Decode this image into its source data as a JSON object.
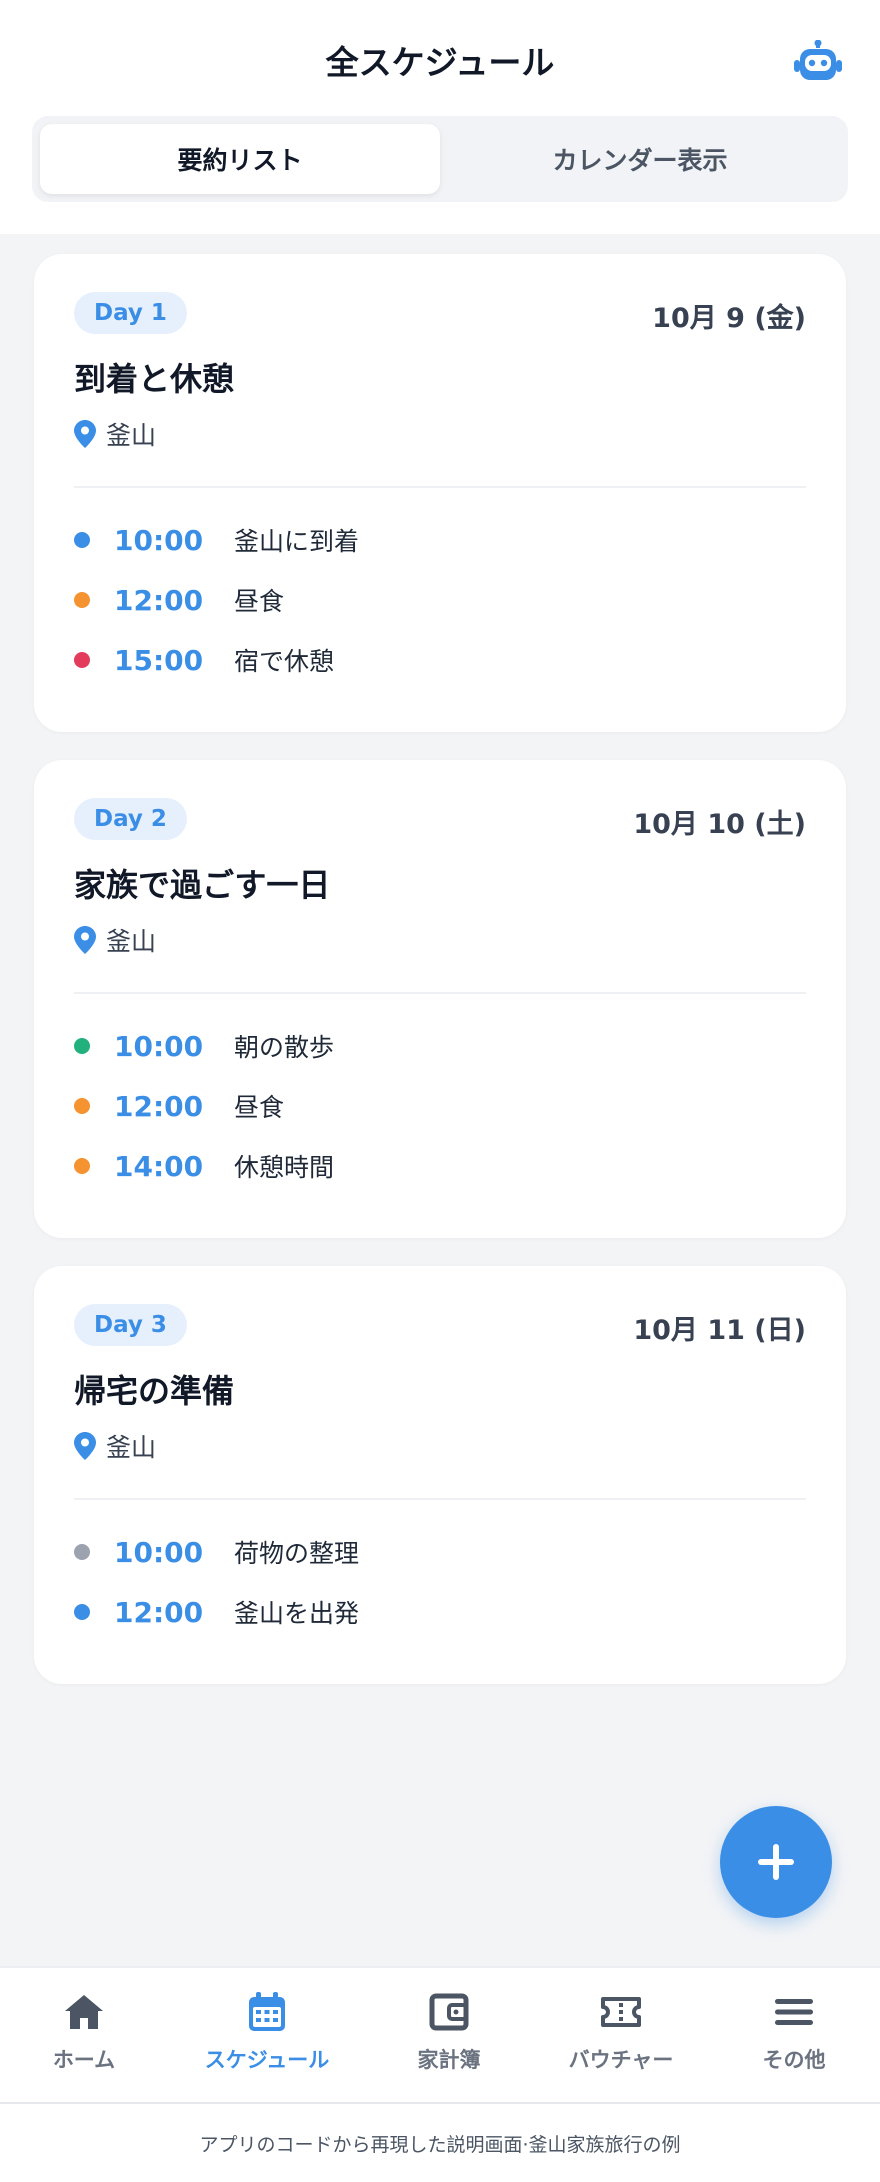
{
  "header": {
    "title": "全スケジュール",
    "bot_icon": "robot-icon",
    "tabs": [
      {
        "label": "要約リスト",
        "active": true
      },
      {
        "label": "カレンダー表示",
        "active": false
      }
    ]
  },
  "days": [
    {
      "badge": "Day 1",
      "date": "10月 9 (金)",
      "title": "到着と休憩",
      "location": "釜山",
      "events": [
        {
          "time": "10:00",
          "name": "釜山に到着",
          "dot_color": "#3b8ee6"
        },
        {
          "time": "12:00",
          "name": "昼食",
          "dot_color": "#f59331"
        },
        {
          "time": "15:00",
          "name": "宿で休憩",
          "dot_color": "#e23b5b"
        }
      ]
    },
    {
      "badge": "Day 2",
      "date": "10月 10 (土)",
      "title": "家族で過ごす一日",
      "location": "釜山",
      "events": [
        {
          "time": "10:00",
          "name": "朝の散歩",
          "dot_color": "#22b07d"
        },
        {
          "time": "12:00",
          "name": "昼食",
          "dot_color": "#f59331"
        },
        {
          "time": "14:00",
          "name": "休憩時間",
          "dot_color": "#f59331"
        }
      ]
    },
    {
      "badge": "Day 3",
      "date": "10月 11 (日)",
      "title": "帰宅の準備",
      "location": "釜山",
      "events": [
        {
          "time": "10:00",
          "name": "荷物の整理",
          "dot_color": "#9ca3af"
        },
        {
          "time": "12:00",
          "name": "釜山を出発",
          "dot_color": "#3b8ee6"
        }
      ]
    }
  ],
  "fab": {
    "icon": "plus-icon"
  },
  "nav": [
    {
      "label": "ホーム",
      "icon": "home-icon",
      "active": false
    },
    {
      "label": "スケジュール",
      "icon": "calendar-icon",
      "active": true
    },
    {
      "label": "家計簿",
      "icon": "wallet-icon",
      "active": false
    },
    {
      "label": "バウチャー",
      "icon": "ticket-icon",
      "active": false
    },
    {
      "label": "その他",
      "icon": "menu-icon",
      "active": false
    }
  ],
  "footer": {
    "caption": "アプリのコードから再現した説明画面·釜山家族旅行の例"
  },
  "colors": {
    "accent": "#3b8ee6",
    "background": "#f3f4f6",
    "text_muted": "#6b7280"
  }
}
